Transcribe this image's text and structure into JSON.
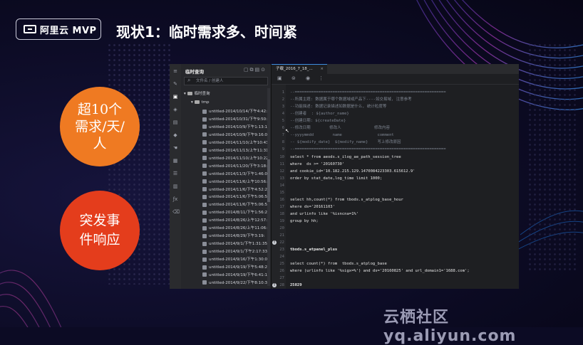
{
  "logo": {
    "text": "阿里云 MVP"
  },
  "title": "现状1：临时需求多、时间紧",
  "bubbles": {
    "first": [
      "超10个",
      "需求/天/",
      "人"
    ],
    "second": [
      "突发事",
      "件响应"
    ]
  },
  "watermark": "云栖社区 yq.aliyun.com",
  "ide": {
    "panel_title": "临时查询",
    "search_placeholder": "文件名 / 创建人",
    "tree": {
      "root": "临时查询",
      "folder": "tmp",
      "files": [
        "untitled-2014/10/14/下午4:42:",
        "untitled-2014/10/31/下午9:50:",
        "untitled-2014/10/9/下午1:13:1!",
        "untitled-2014/10/9/下午9:16:0",
        "untitled-2014/11/10/上午10:43",
        "untitled-2014/11/13/上午11:31:",
        "untitled-2014/11/10/上午10:22",
        "untitled-2014/11/20/下午3:18:",
        "untitled-2014/11/3/下午1:46:0",
        "untitled-2014/11/6/上午10:56:",
        "untitled-2014/11/6/下午4:52:2",
        "untitled-2014/11/6/下午5:06:5",
        "untitled-2014/11/6/下午5:06:5",
        "untitled-2014/8/11/下午1:56:2",
        "untitled-2014/8/26/上午12:57:",
        "untitled-2014/8/26/上午11:06:",
        "untitled-2014/8/29/下午3:19:",
        "untitled-2014/9/1/下午1:31:35",
        "untitled-2014/9/1/下午2:17:33",
        "untitled-2014/9/16/下午1:30:0",
        "untitled-2014/9/19/下午5:48:2",
        "untitled-2014/9/19/下午6:41:1",
        "untitled-2014/9/22/下午8:10:3"
      ]
    },
    "tab_label": "子载_2016_7_18_...",
    "code_lines": [
      {
        "n": "1",
        "t": "--================================================================",
        "c": "c"
      },
      {
        "n": "2",
        "t": "--所属主题: 数据属于哪个数据域或产品下----如交易域, 注意参考",
        "c": "c"
      },
      {
        "n": "3",
        "t": "--功能描述: 数据记录描述如数据是什么, 统计粒度等",
        "c": "c"
      },
      {
        "n": "4",
        "t": "--创建者  : ${author_name}",
        "c": "c"
      },
      {
        "n": "5",
        "t": "--创建日期: ${createDate}",
        "c": "c"
      },
      {
        "n": "6",
        "t": "--修改日期        修改人              修改内容",
        "c": "c"
      },
      {
        "n": "7",
        "t": "--yyyymmdd        name               comment",
        "c": "c"
      },
      {
        "n": "8",
        "t": "-- ${modify_date}  ${modify_name}    写上修改原因",
        "c": "c"
      },
      {
        "n": "9",
        "t": "--================================================================",
        "c": "c"
      },
      {
        "n": "10",
        "t": "select * from aeods.s_ilog_ae_path_session_tree",
        "c": "s"
      },
      {
        "n": "11",
        "t": "where  ds >= '20160730'",
        "c": "s"
      },
      {
        "n": "12",
        "t": "and cookie_id='10.182.215.129.1470084223303.615612.9'",
        "c": "s"
      },
      {
        "n": "13",
        "t": "order by stat_date,log_time limit 1000;",
        "c": "s"
      },
      {
        "n": "14",
        "t": "",
        "c": "s"
      },
      {
        "n": "15",
        "t": "",
        "c": "s"
      },
      {
        "n": "16",
        "t": "select hh,count(*) from tbods.s_atplog_base_hour",
        "c": "s"
      },
      {
        "n": "17",
        "t": "where ds='20161103'",
        "c": "s"
      },
      {
        "n": "18",
        "t": "and urlinfo like '%isncna=1%'",
        "c": "s"
      },
      {
        "n": "19",
        "t": "group by hh;",
        "c": "s"
      },
      {
        "n": "20",
        "t": "",
        "c": "s"
      },
      {
        "n": "21",
        "t": "",
        "c": "s"
      },
      {
        "n": "22",
        "t": "",
        "c": "s"
      },
      {
        "n": "23",
        "t": "tbods.s_atpanel_plus",
        "c": "k"
      },
      {
        "n": "24",
        "t": "",
        "c": "s"
      },
      {
        "n": "25",
        "t": "select count(*) from  tbods.s_atplog_base",
        "c": "s"
      },
      {
        "n": "26",
        "t": "where (urlinfo like '%sigx=%') and ds='20160825' and url_domain1='1688.com';",
        "c": "s"
      },
      {
        "n": "27",
        "t": "",
        "c": "s"
      },
      {
        "n": "28",
        "t": "25029",
        "c": "k"
      }
    ]
  }
}
